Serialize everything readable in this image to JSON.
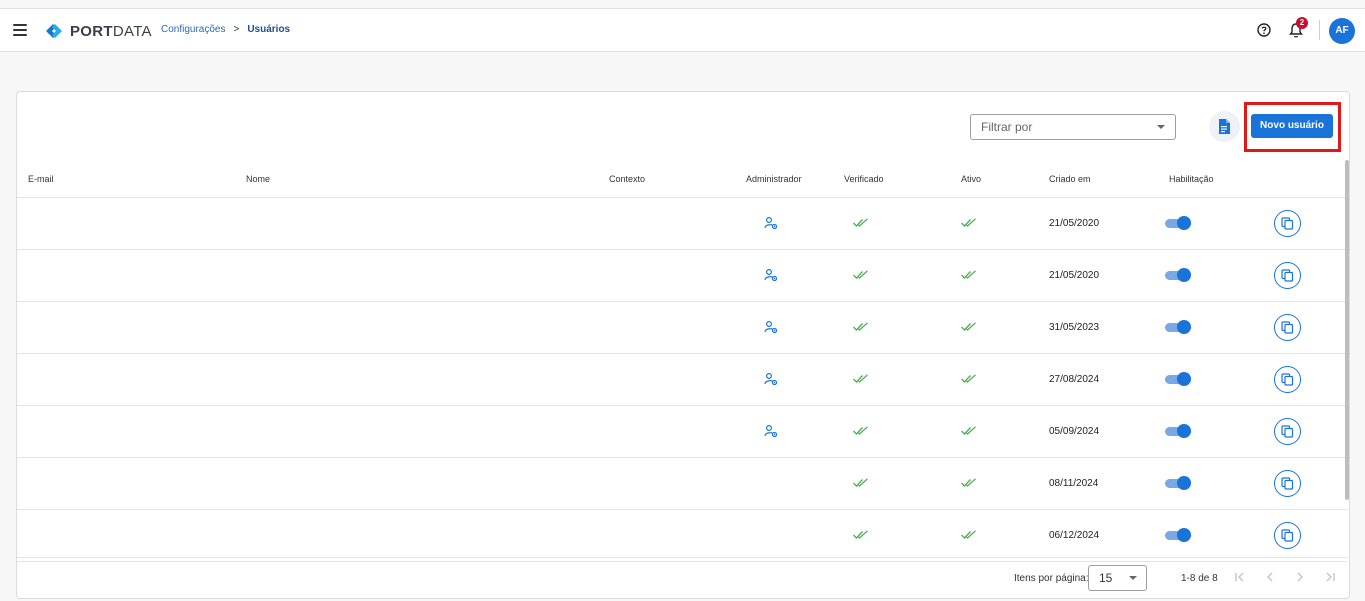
{
  "header": {
    "brand_main": "PORT",
    "brand_sub": "DATA",
    "breadcrumb": [
      "Configurações",
      ">",
      "Usuários"
    ],
    "notification_count": "2",
    "avatar_initials": "AF"
  },
  "toolbar": {
    "filter_placeholder": "Filtrar por",
    "new_user_label": "Novo usuário"
  },
  "table": {
    "columns": [
      "E-mail",
      "Nome",
      "Contexto",
      "Administrador",
      "Verificado",
      "Ativo",
      "Criado em",
      "Habilitação"
    ],
    "rows": [
      {
        "admin": true,
        "verified": true,
        "active": true,
        "created": "21/05/2020",
        "enabled": true
      },
      {
        "admin": true,
        "verified": true,
        "active": true,
        "created": "21/05/2020",
        "enabled": true
      },
      {
        "admin": true,
        "verified": true,
        "active": true,
        "created": "31/05/2023",
        "enabled": true
      },
      {
        "admin": true,
        "verified": true,
        "active": true,
        "created": "27/08/2024",
        "enabled": true
      },
      {
        "admin": true,
        "verified": true,
        "active": true,
        "created": "05/09/2024",
        "enabled": true
      },
      {
        "admin": false,
        "verified": true,
        "active": true,
        "created": "08/11/2024",
        "enabled": true
      },
      {
        "admin": false,
        "verified": true,
        "active": true,
        "created": "06/12/2024",
        "enabled": true
      }
    ]
  },
  "pagination": {
    "items_per_page_label": "Itens por página:",
    "items_per_page": "15",
    "range": "1-8 de 8"
  },
  "colors": {
    "primary": "#1a73d8",
    "check": "#4caf50",
    "highlight": "#e01818",
    "badge": "#c8102e"
  }
}
